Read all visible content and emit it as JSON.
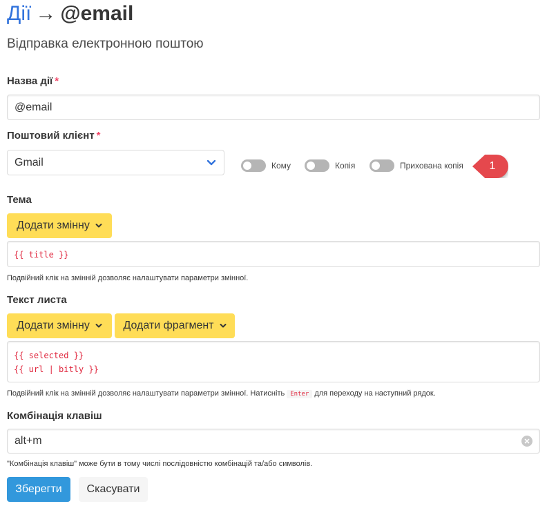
{
  "header": {
    "breadcrumb": "Дії",
    "arrow": "→",
    "action_name": "@email",
    "subtitle": "Відправка електронною поштою"
  },
  "action_name_field": {
    "label": "Назва дії",
    "required_mark": "*",
    "value": "@email"
  },
  "mail_client": {
    "label": "Поштовий клієнт",
    "required_mark": "*",
    "selected": "Gmail",
    "toggles": [
      {
        "label": "Кому",
        "on": false
      },
      {
        "label": "Копія",
        "on": false
      },
      {
        "label": "Прихована копія",
        "on": false
      }
    ],
    "marker": "1"
  },
  "subject": {
    "label": "Тема",
    "add_variable_label": "Додати змінну",
    "code_lines": [
      "{{ title }}"
    ],
    "help": "Подвійний клік на змінній дозволяє налаштувати параметри змінної."
  },
  "body_text": {
    "label": "Текст листа",
    "add_variable_label": "Додати змінну",
    "add_fragment_label": "Додати фрагмент",
    "code_lines": [
      "{{ selected }}",
      "{{ url | bitly }}"
    ],
    "help_before": "Подвійний клік на змінній дозволяє налаштувати параметри змінної. Натисніть",
    "help_key": "Enter",
    "help_after": "для переходу на наступний рядок."
  },
  "shortcut": {
    "label": "Комбінація клавіш",
    "value": "alt+m",
    "help": "\"Комбінація клавіш\" може бути в тому числі послідовністю комбінацій та/або символів."
  },
  "actions": {
    "save_label": "Зберегти",
    "cancel_label": "Скасувати"
  },
  "colors": {
    "link_blue": "#3273dc",
    "warning_yellow": "#ffdd57",
    "primary_blue": "#3298dc",
    "code_red": "#e0283f",
    "marker_red": "#e5484d"
  },
  "icons": {
    "select_chevron": "chevron-down-icon",
    "dropdown_caret": "caret-down-icon",
    "clear": "clear-circle-icon"
  }
}
